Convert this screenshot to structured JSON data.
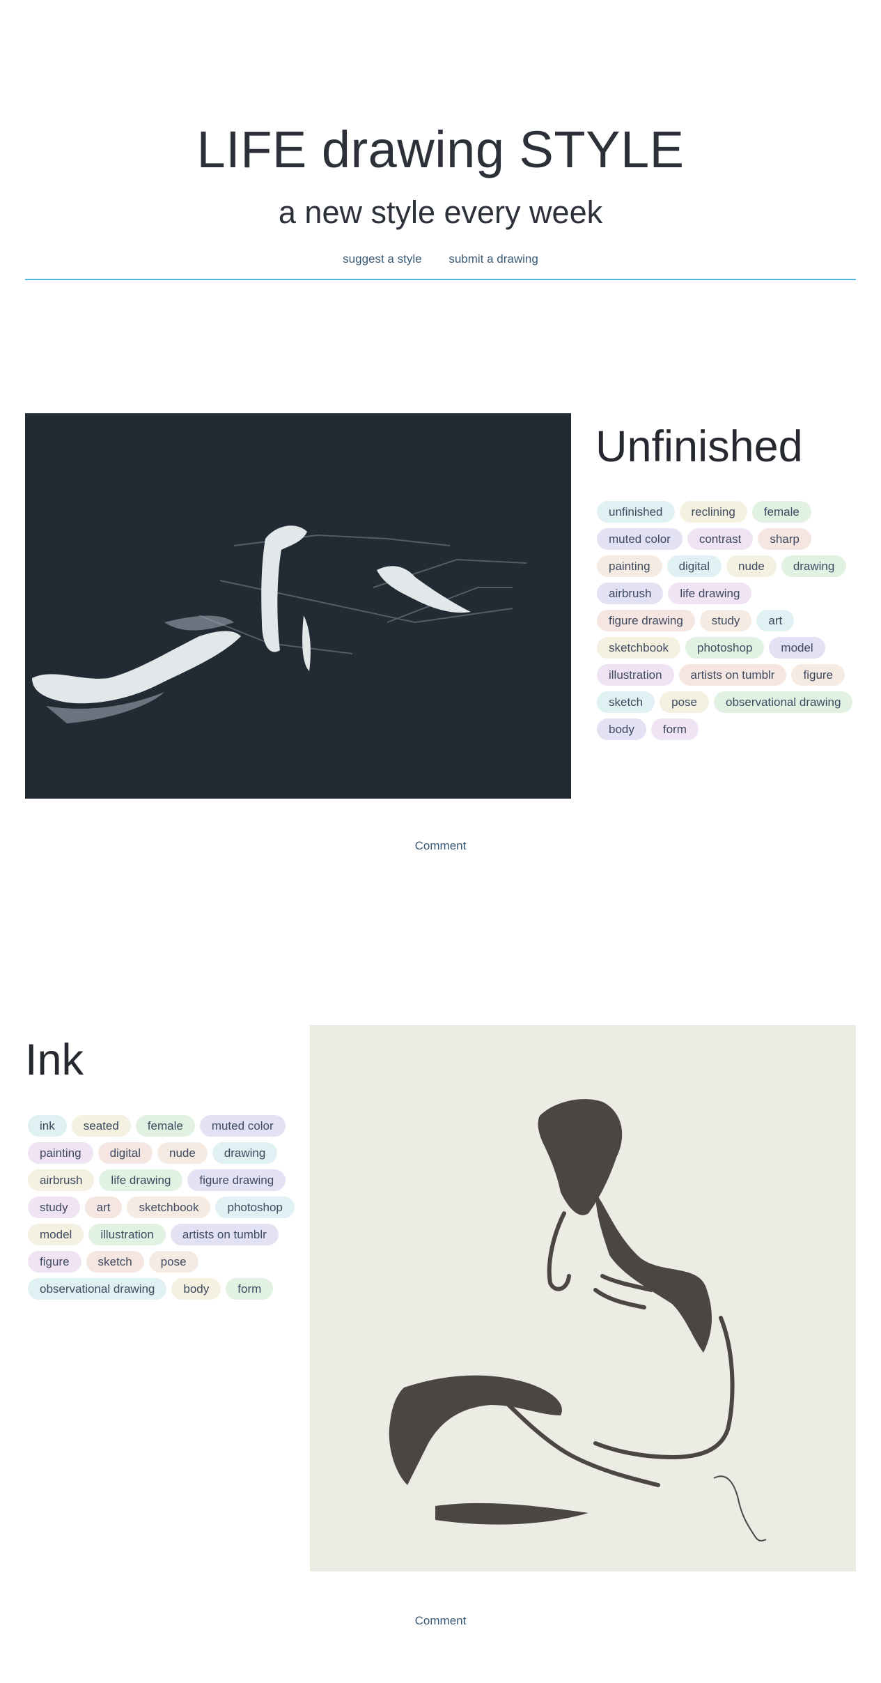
{
  "header": {
    "title": "LIFE drawing STYLE",
    "tagline": "a new style every week",
    "nav": [
      "suggest a style",
      "submit a drawing"
    ]
  },
  "tag_palette": [
    "#e0f1f3",
    "#f4f1e0",
    "#e1f2e3",
    "#e2e2f4",
    "#efe3f4",
    "#f5e6e2",
    "#f5ebe3"
  ],
  "posts": [
    {
      "title": "Unfinished",
      "image_alt": "reclining figure sketch",
      "tags": [
        "unfinished",
        "reclining",
        "female",
        "muted color",
        "contrast",
        "sharp",
        "painting",
        "digital",
        "nude",
        "drawing",
        "airbrush",
        "life drawing",
        "figure drawing",
        "study",
        "art",
        "sketchbook",
        "photoshop",
        "model",
        "illustration",
        "artists on tumblr",
        "figure",
        "sketch",
        "pose",
        "observational drawing",
        "body",
        "form"
      ],
      "comment": "Comment"
    },
    {
      "title": "Ink",
      "image_alt": "seated figure ink drawing",
      "tags": [
        "ink",
        "seated",
        "female",
        "muted color",
        "painting",
        "digital",
        "nude",
        "drawing",
        "airbrush",
        "life drawing",
        "figure drawing",
        "study",
        "art",
        "sketchbook",
        "photoshop",
        "model",
        "illustration",
        "artists on tumblr",
        "figure",
        "sketch",
        "pose",
        "observational drawing",
        "body",
        "form"
      ],
      "comment": "Comment"
    }
  ]
}
